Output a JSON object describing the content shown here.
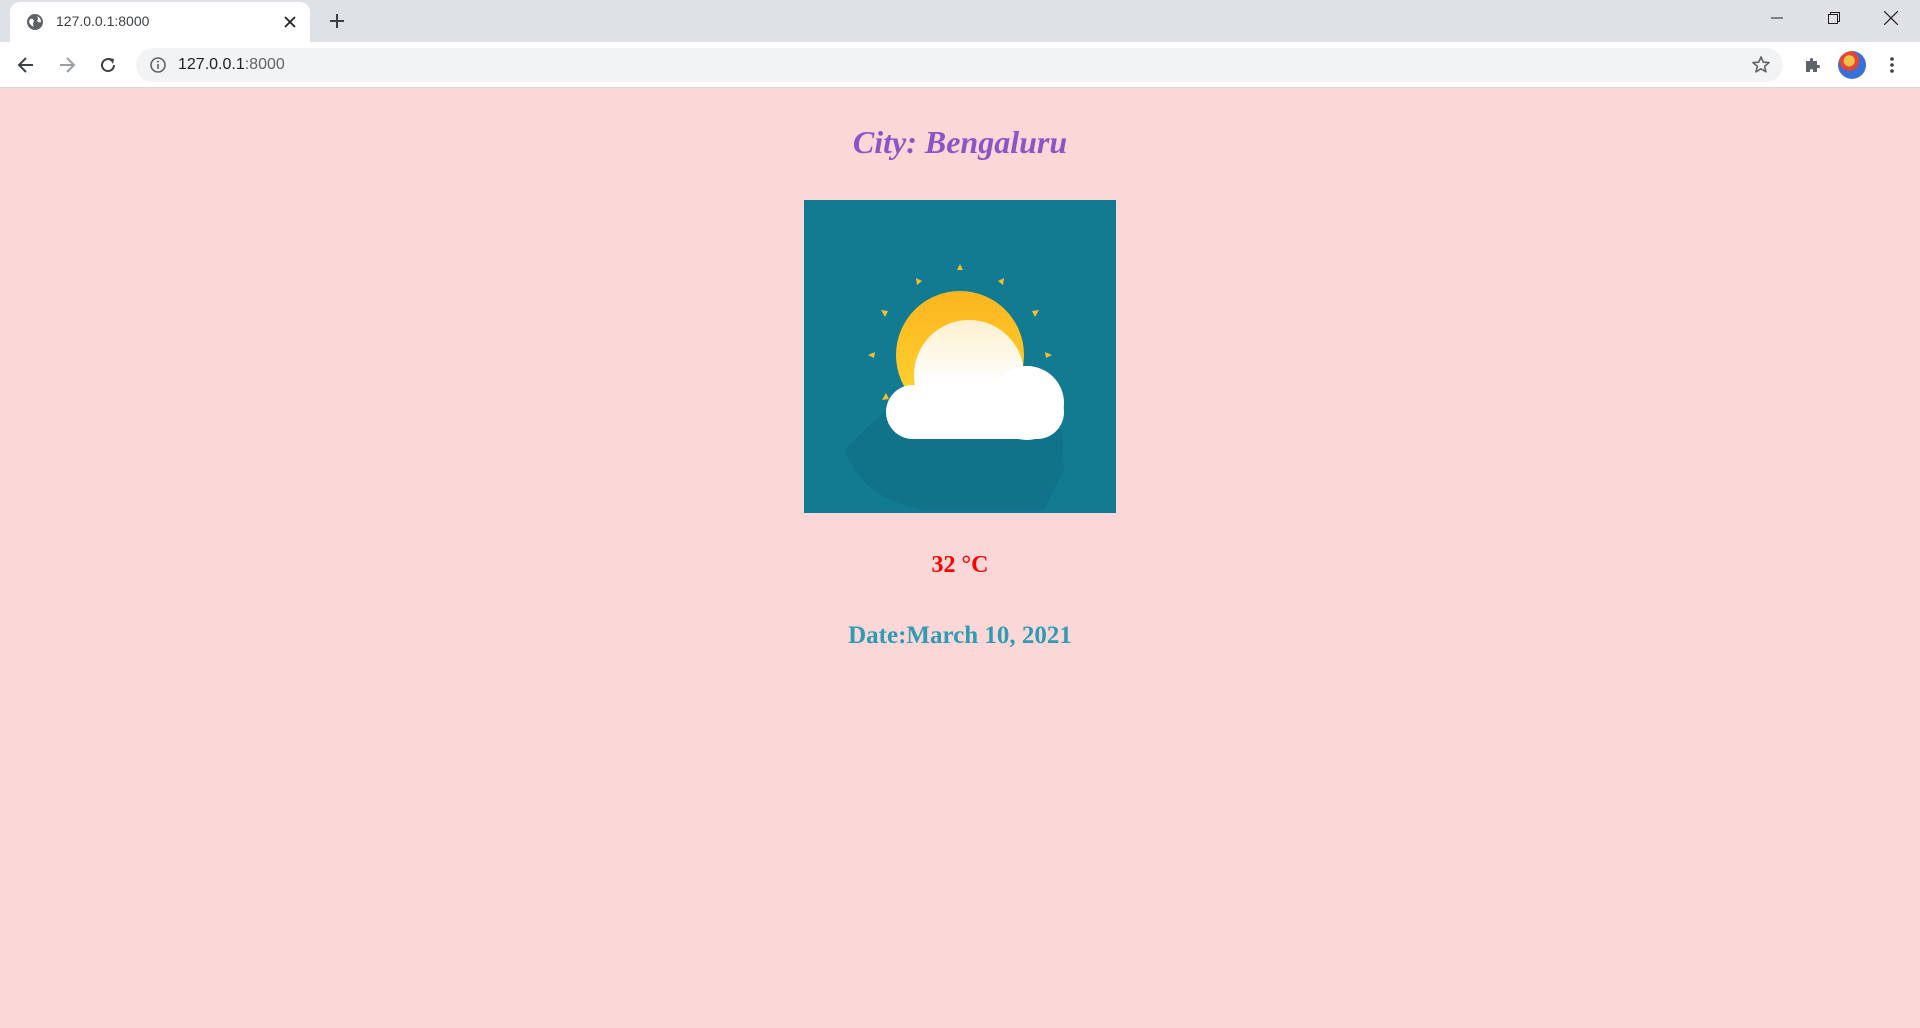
{
  "browser": {
    "tab_title": "127.0.0.1:8000",
    "url_host": "127.0.0.1",
    "url_port": ":8000",
    "icons": {
      "tab": "globe-icon",
      "close_tab": "close-icon",
      "new_tab": "plus-icon",
      "back": "back-arrow-icon",
      "forward": "forward-arrow-icon",
      "reload": "reload-icon",
      "info": "info-icon",
      "bookmark": "star-icon",
      "extensions": "puzzle-icon",
      "menu": "kebab-menu-icon",
      "minimize": "minimize-icon",
      "restore": "restore-icon",
      "close_window": "close-window-icon"
    }
  },
  "weather": {
    "city": "City: Bengaluru",
    "image": "partly-cloudy-sun-icon",
    "temperature": "32 °C",
    "date": "Date:March 10, 2021"
  },
  "colors": {
    "background": "#fbd7d7",
    "city": "#8a55c4",
    "temperature": "#ff0000",
    "date": "#2f9cb4",
    "image_bg": "#127b92"
  }
}
